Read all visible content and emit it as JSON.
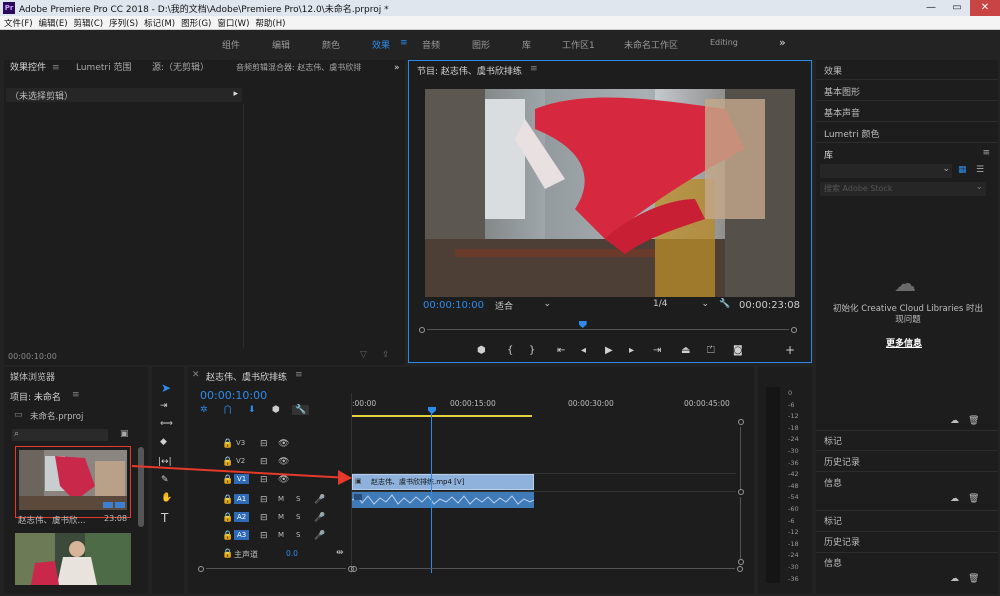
{
  "window": {
    "title": "Adobe Premiere Pro CC 2018 - D:\\我的文档\\Adobe\\Premiere Pro\\12.0\\未命名.prproj *",
    "logo": "Pr",
    "controls": [
      "—",
      "▭",
      "✕"
    ]
  },
  "menu": [
    "文件(F)",
    "编辑(E)",
    "剪辑(C)",
    "序列(S)",
    "标记(M)",
    "图形(G)",
    "窗口(W)",
    "帮助(H)"
  ],
  "workspaces": {
    "items": [
      "组件",
      "编辑",
      "颜色",
      "效果",
      "音频",
      "图形",
      "库",
      "工作区1",
      "未命名工作区",
      "Editing"
    ],
    "active": "效果",
    "menu_icon": "≡",
    "more": "»"
  },
  "source_panel": {
    "tabs": [
      "效果控件",
      "Lumetri 范围",
      "源:（无剪辑）",
      "音频剪辑混合器: 赵志伟、虞书欣排"
    ],
    "more": "»",
    "no_clip": "（未选择剪辑）",
    "timecode": "00:00:10:00"
  },
  "program_monitor": {
    "title": "节目: 赵志伟、虞书欣排练",
    "current_time": "00:00:10:00",
    "fit": "适合",
    "resolution": "1/4",
    "duration": "00:00:23:08",
    "playhead_fraction": 0.43
  },
  "right_panel": {
    "items_top": [
      "效果",
      "基本图形",
      "基本声音",
      "Lumetri 颜色",
      "库"
    ],
    "search_placeholder": "搜索 Adobe Stock",
    "cc_message": "初始化 Creative Cloud Libraries 时出现问题",
    "more_info": "更多信息",
    "items_mid": [
      "标记",
      "历史记录",
      "信息"
    ],
    "items_bottom": [
      "标记",
      "历史记录",
      "信息"
    ]
  },
  "project_panel": {
    "tab": "媒体浏览器",
    "project_label": "项目: 未命名",
    "file_name": "未命名.prproj",
    "clip1_name": "赵志伟、虞书欣...",
    "clip1_duration": "23:08"
  },
  "timeline": {
    "title": "赵志伟、虞书欣排练",
    "timecode": "00:00:10:00",
    "ruler": [
      ":00:00",
      "00:00:15:00",
      "00:00:30:00",
      "00:00:45:00"
    ],
    "tracks_video": [
      "V3",
      "V2",
      "V1"
    ],
    "tracks_audio": [
      "A1",
      "A2",
      "A3"
    ],
    "master_label": "主声道",
    "master_value": "0.0",
    "track_m": "M",
    "track_s": "S",
    "video_clip": "赵志伟、虞书欣排练.mp4 [V]"
  },
  "meter": {
    "ticks": [
      "0",
      "-6",
      "-12",
      "-18",
      "-24",
      "-30",
      "-36",
      "-42",
      "-48",
      "-54",
      "-60",
      "-6",
      "-12",
      "-18",
      "-24",
      "-30",
      "-36"
    ]
  },
  "colors": {
    "accent": "#2d8ceb",
    "annotation": "#e53a2a",
    "video_clip": "#8fb2dc",
    "audio_clip": "#3f7bb8"
  }
}
